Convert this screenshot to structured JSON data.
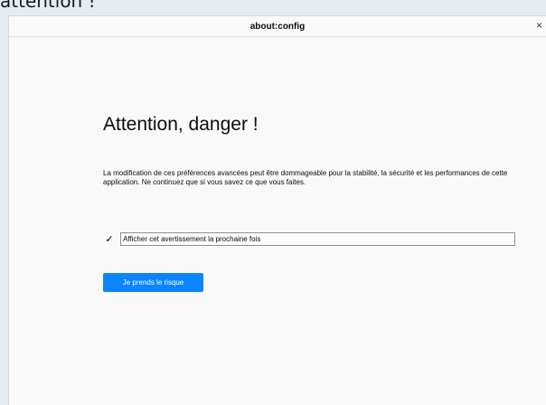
{
  "background_text": "attention !",
  "window": {
    "title": "about:config",
    "close_glyph": "×"
  },
  "warning": {
    "heading": "Attention, danger !",
    "description": "La modification de ces préférences avancées peut être dommageable pour la stabilité, la sécurité et les performances de cette application. Ne continuez que si vous savez ce que vous faites.",
    "checkbox_checked": true,
    "checkbox_glyph": "✓",
    "checkbox_label": "Afficher cet avertissement la prochaine fois",
    "button_label": "Je prends le risque"
  },
  "colors": {
    "accent": "#0a84ff",
    "page_background": "#e5edf3",
    "window_background": "#f9f9fa"
  }
}
